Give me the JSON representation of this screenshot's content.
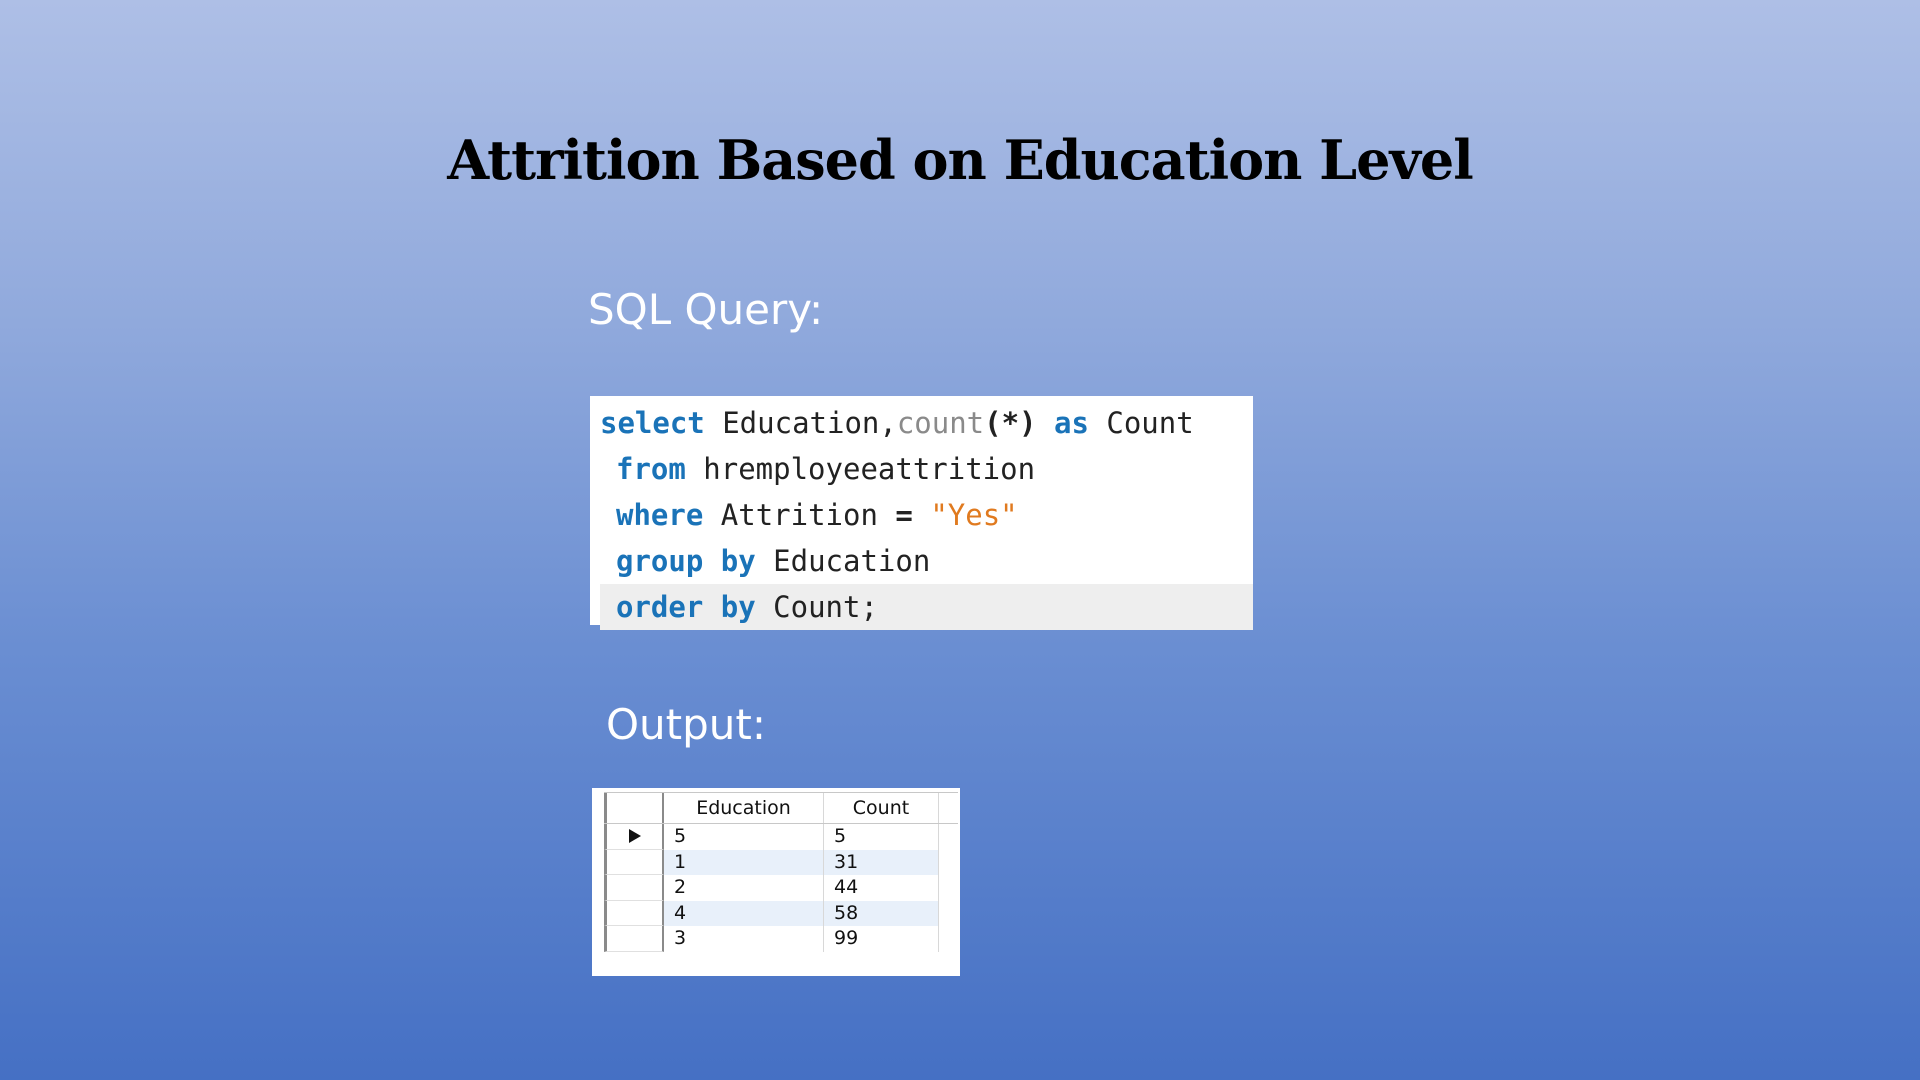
{
  "slide": {
    "title": "Attrition Based on Education Level",
    "sql_label": "SQL Query:",
    "output_label": "Output:"
  },
  "sql": {
    "line1": {
      "kw1": "select",
      "t1": " Education,",
      "fn": "count",
      "t2": "(*)",
      "kw2": "as",
      "t3": " Count"
    },
    "line2": {
      "kw": "from",
      "t": " hremployeeattrition"
    },
    "line3": {
      "kw": "where",
      "t1": " Attrition ",
      "op": "=",
      "t2": " ",
      "str": "\"Yes\""
    },
    "line4": {
      "kw1": "group",
      "kw2": "by",
      "t": " Education"
    },
    "line5": {
      "kw1": "order",
      "kw2": "by",
      "t": " Count;"
    }
  },
  "result": {
    "columns": [
      "Education",
      "Count"
    ],
    "rows": [
      {
        "education": "5",
        "count": "5"
      },
      {
        "education": "1",
        "count": "31"
      },
      {
        "education": "2",
        "count": "44"
      },
      {
        "education": "4",
        "count": "58"
      },
      {
        "education": "3",
        "count": "99"
      }
    ],
    "pointer_icon": "row-pointer-icon"
  },
  "colors": {
    "keyword": "#1a73b8",
    "function": "#8a8a8a",
    "string": "#e07a1f",
    "background_top": "#aebfe6",
    "background_bottom": "#4570c4"
  }
}
